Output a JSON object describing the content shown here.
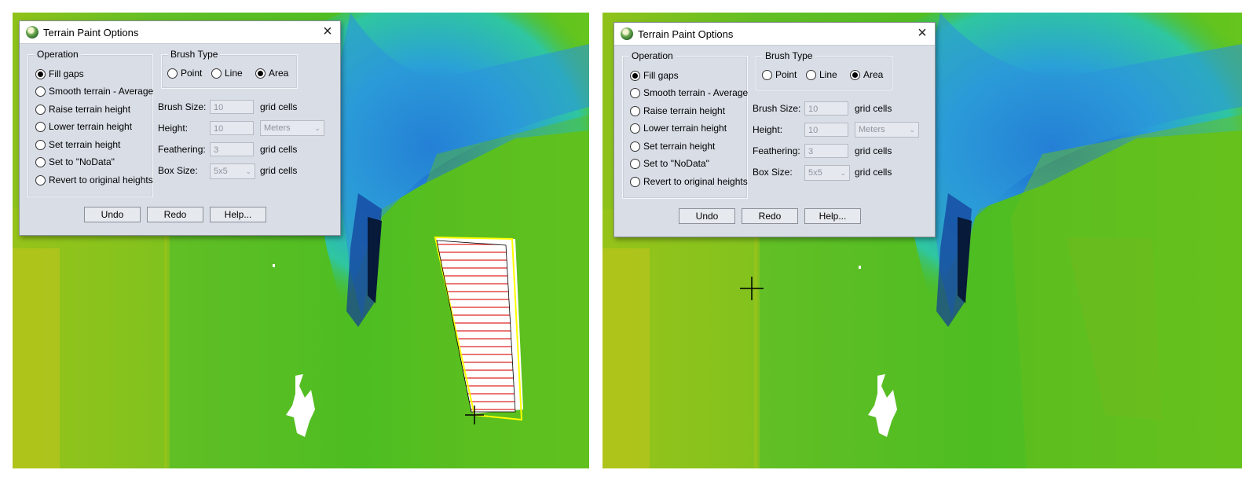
{
  "dialog": {
    "title": "Terrain Paint Options",
    "close_label": "×",
    "operation": {
      "label": "Operation",
      "options": [
        "Fill gaps",
        "Smooth terrain - Average",
        "Raise terrain height",
        "Lower terrain height",
        "Set terrain height",
        "Set to \"NoData\"",
        "Revert to original heights"
      ],
      "selected": "Fill gaps"
    },
    "brush_type": {
      "label": "Brush Type",
      "options": [
        "Point",
        "Line",
        "Area"
      ],
      "selected": "Area"
    },
    "fields": {
      "brush_size": {
        "label": "Brush Size:",
        "value": "10",
        "unit": "grid cells"
      },
      "height": {
        "label": "Height:",
        "value": "10",
        "unit": "Meters"
      },
      "feathering": {
        "label": "Feathering:",
        "value": "3",
        "unit": "grid cells"
      },
      "box_size": {
        "label": "Box Size:",
        "value": "5x5",
        "unit": "grid cells"
      }
    },
    "buttons": {
      "undo": "Undo",
      "redo": "Redo",
      "help": "Help..."
    }
  },
  "colors": {
    "dialog_bg": "#d8dde6",
    "selection_outline": "#ffff00",
    "fill_hatch": "#e03030",
    "terrain_high": "#1b6fd0",
    "terrain_low": "#3fbf1f"
  },
  "icons": [
    "app-icon",
    "close-icon",
    "crosshair-cursor-icon"
  ]
}
